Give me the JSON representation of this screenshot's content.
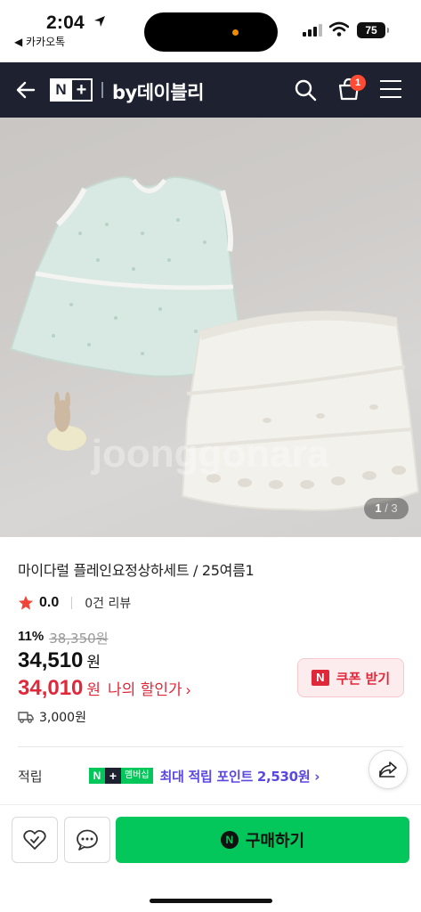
{
  "status_bar": {
    "time": "2:04",
    "back_app": "◀ 카카오톡",
    "battery": "75"
  },
  "header": {
    "brand_left": "N",
    "brand_right": "+",
    "store_name": "by데이블리",
    "cart_count": "1"
  },
  "gallery": {
    "current": "1",
    "separator": " / ",
    "total": "3",
    "watermark": "joonggonara"
  },
  "product": {
    "title": "마이다럴 플레인요정상하세트 / 25여름1",
    "rating": "0.0",
    "review_count": "0건 리뷰",
    "discount_percent": "11%",
    "original_price": "38,350원",
    "price": "34,510",
    "price_unit": "원",
    "my_price": "34,010",
    "my_price_unit": "원",
    "my_price_label": "나의 할인가",
    "my_price_chevron": "›",
    "coupon_label": "쿠폰 받기",
    "coupon_badge": "N",
    "shipping_fee": "3,000원"
  },
  "points": {
    "label": "적립",
    "badge_n": "N",
    "badge_plus": "+",
    "badge_membership": "멤버십",
    "text": "최대 적립 포인트 2,530원 ›"
  },
  "bottom_bar": {
    "buy_badge": "N",
    "buy_label": "구매하기"
  },
  "colors": {
    "header_bg": "#1e2230",
    "naver_green": "#03c75a",
    "sale_red": "#e0283b",
    "points_purple": "#5a48e0",
    "cart_badge": "#ff4b33"
  },
  "icons": [
    "back-arrow-icon",
    "search-icon",
    "cart-icon",
    "menu-icon",
    "star-icon",
    "truck-icon",
    "share-icon",
    "like-icon",
    "talk-icon",
    "location-arrow-icon",
    "signal-icon",
    "wifi-icon"
  ]
}
